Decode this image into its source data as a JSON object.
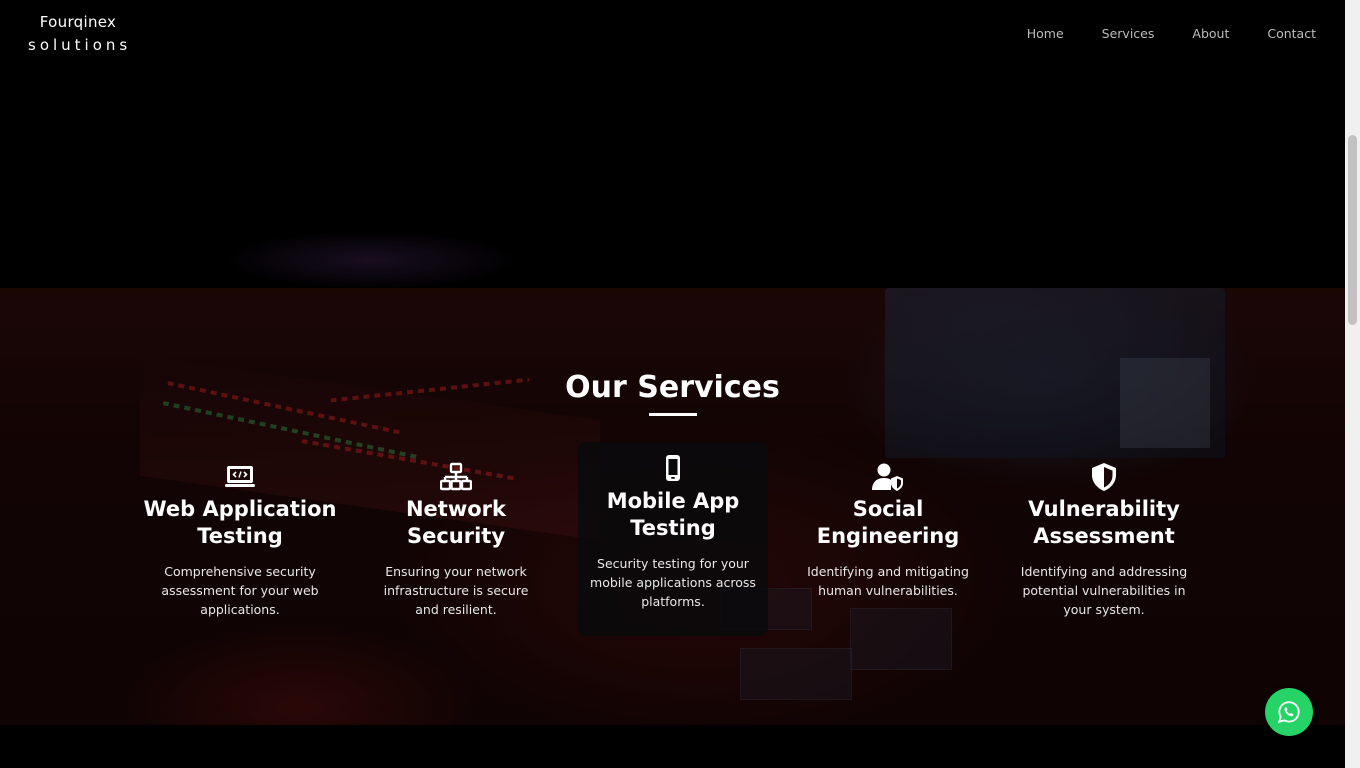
{
  "brand": {
    "line1": "Fourqinex",
    "line2": "solutions"
  },
  "nav": {
    "items": [
      {
        "label": "Home"
      },
      {
        "label": "Services"
      },
      {
        "label": "About"
      },
      {
        "label": "Contact"
      }
    ]
  },
  "services": {
    "title": "Our Services",
    "cards": [
      {
        "icon": "code-laptop-icon",
        "title": "Web Application Testing",
        "desc": "Comprehensive security assessment for your web applications."
      },
      {
        "icon": "network-icon",
        "title": "Network Security",
        "desc": "Ensuring your network infrastructure is secure and resilient."
      },
      {
        "icon": "mobile-phone-icon",
        "title": "Mobile App Testing",
        "desc": "Security testing for your mobile applications across platforms."
      },
      {
        "icon": "user-shield-icon",
        "title": "Social Engineering",
        "desc": "Identifying and mitigating human vulnerabilities."
      },
      {
        "icon": "shield-icon",
        "title": "Vulnerability Assessment",
        "desc": "Identifying and addressing potential vulnerabilities in your system."
      }
    ]
  },
  "floating": {
    "whatsapp_icon": "whatsapp-icon",
    "whatsapp_color": "#25d366"
  },
  "colors": {
    "background": "#000000",
    "text": "#ffffff",
    "nav_text": "#bdbdbd"
  }
}
